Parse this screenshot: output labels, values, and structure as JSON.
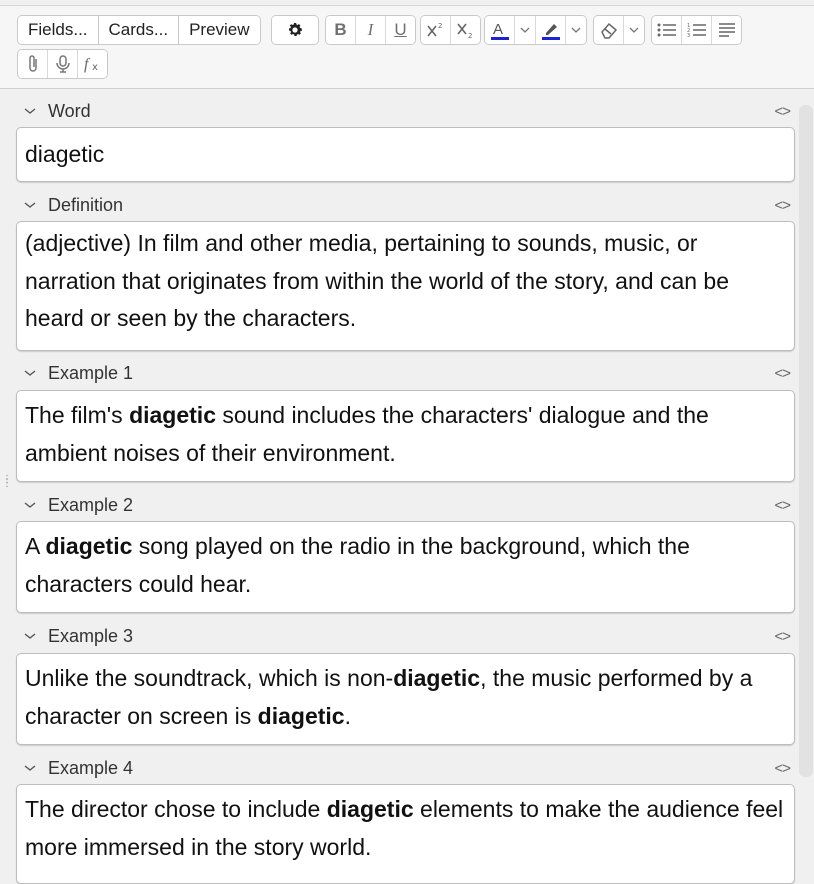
{
  "toolbar": {
    "fields_label": "Fields...",
    "cards_label": "Cards...",
    "preview_label": "Preview",
    "accent_color": "#1e23d0"
  },
  "fields": [
    {
      "name": "Word",
      "content": "diagetic"
    },
    {
      "name": "Definition",
      "content": "(adjective) In film and other media, pertaining to sounds, music, or narration that originates from within the world of the story, and can be heard or seen by the characters."
    },
    {
      "name": "Example 1",
      "parts": [
        "The film's ",
        "diagetic",
        " sound includes the characters' dialogue and the ambient noises of their environment."
      ]
    },
    {
      "name": "Example 2",
      "parts": [
        "A ",
        "diagetic",
        " song played on the radio in the background, which the characters could hear."
      ]
    },
    {
      "name": "Example 3",
      "parts": [
        "Unlike the soundtrack, which is non-",
        "diagetic",
        ", the music performed by a character on screen is ",
        "diagetic",
        "."
      ]
    },
    {
      "name": "Example 4",
      "parts": [
        "The director chose to include ",
        "diagetic",
        " elements to make the audience feel more immersed in the story world."
      ]
    }
  ],
  "html_toggle_glyph": "<>"
}
